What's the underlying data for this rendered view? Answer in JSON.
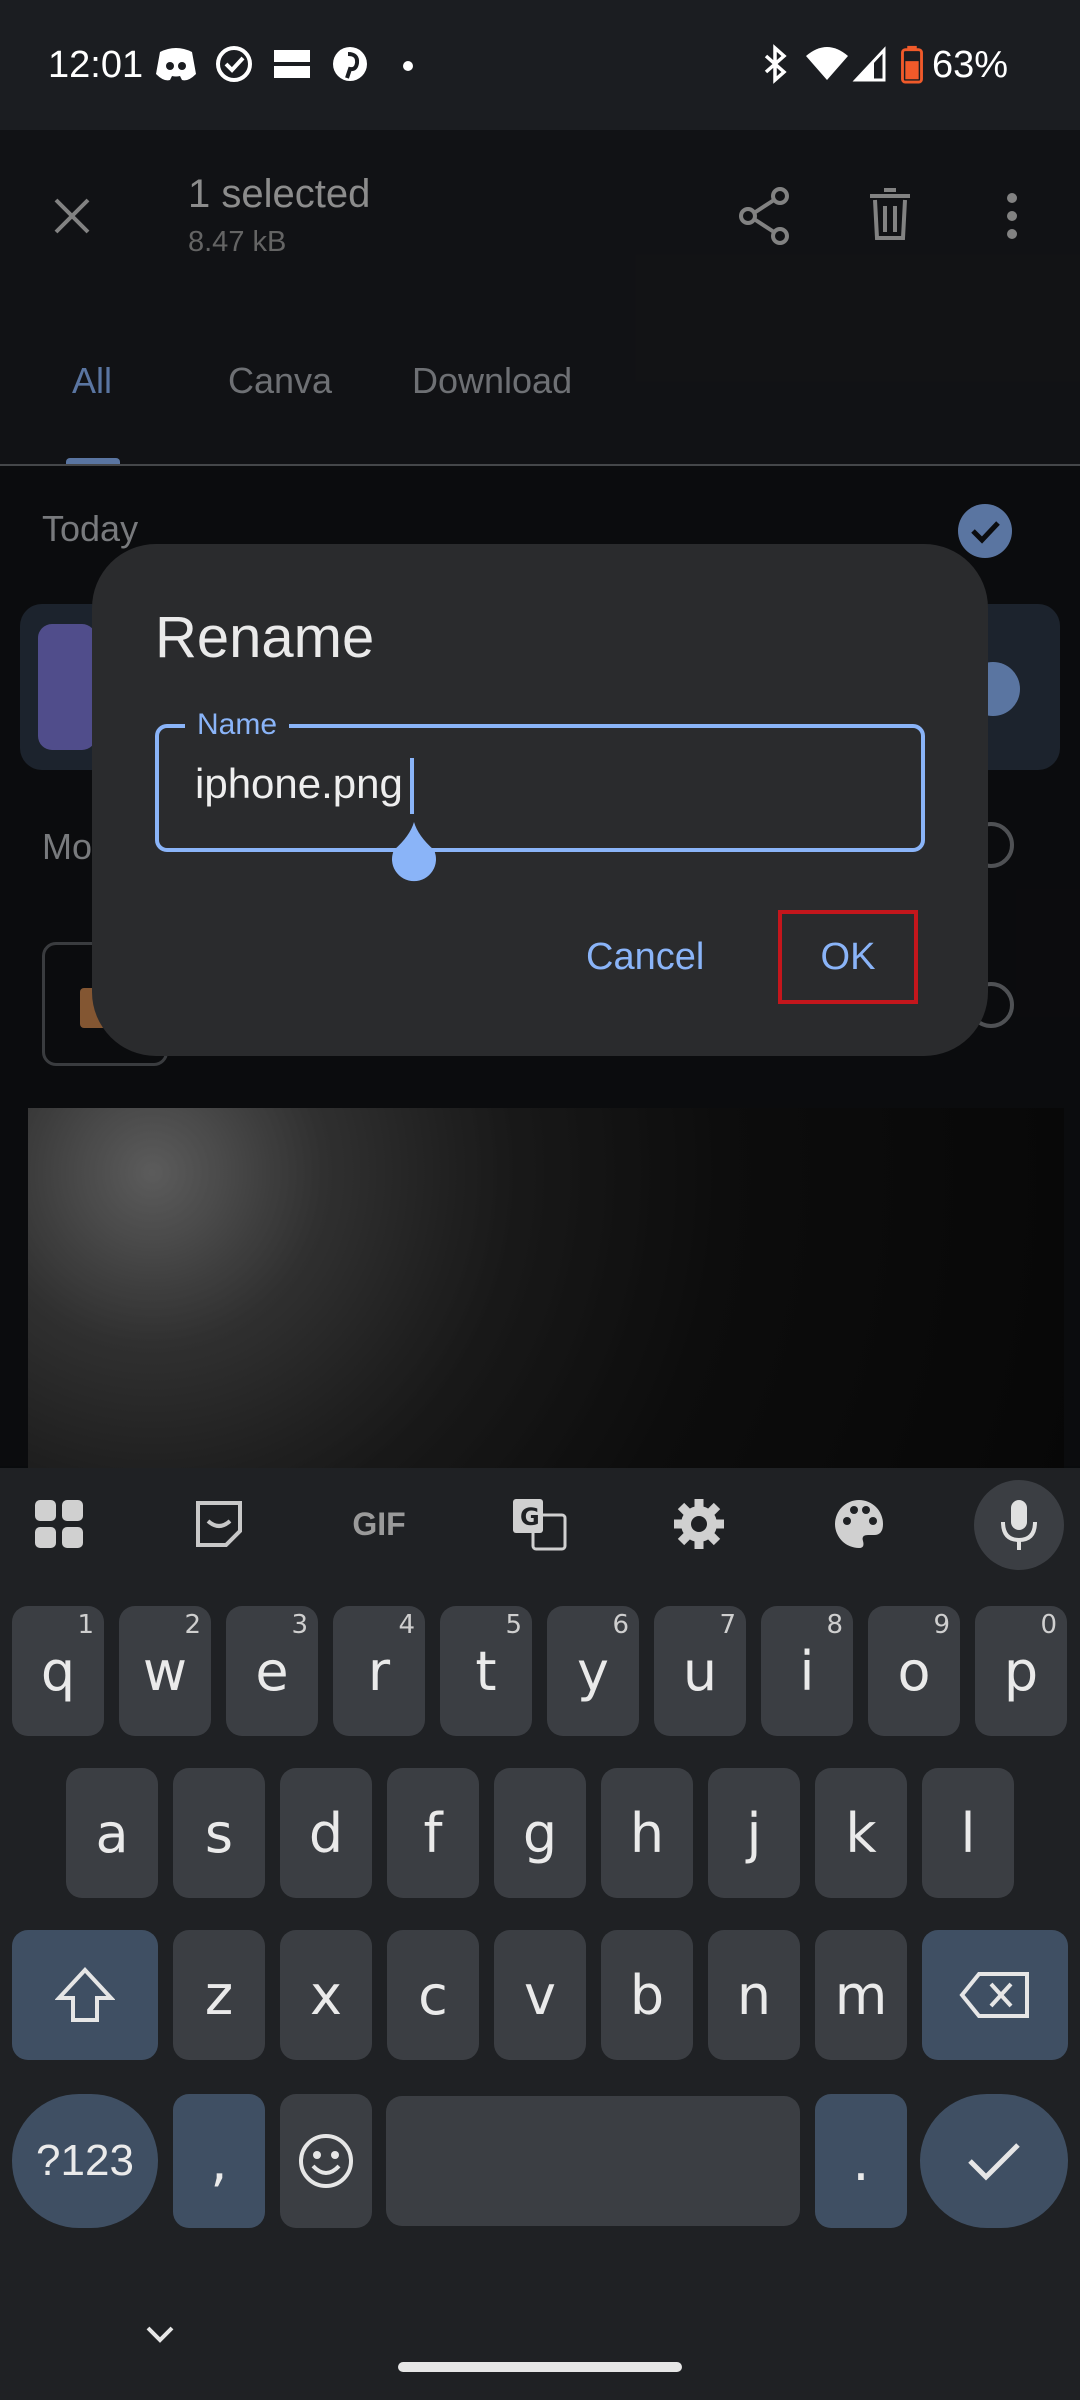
{
  "status_bar": {
    "time": "12:01",
    "battery": "63%",
    "left_icons": [
      "discord-icon",
      "check-circle-icon",
      "temu-icon",
      "pinterest-icon",
      "dot-icon"
    ],
    "right_icons": [
      "bluetooth-icon",
      "wifi-icon",
      "signal-icon",
      "battery-icon"
    ]
  },
  "app_bar": {
    "title": "1 selected",
    "subtitle": "8.47 kB",
    "actions": [
      "close-icon",
      "share-icon",
      "delete-icon",
      "more-vert-icon"
    ]
  },
  "tabs": [
    {
      "label": "All",
      "active": true
    },
    {
      "label": "Canva",
      "active": false
    },
    {
      "label": "Download",
      "active": false
    }
  ],
  "content": {
    "section_today": "Today",
    "section_partial": "Mo"
  },
  "dialog": {
    "title": "Rename",
    "field_label": "Name",
    "field_value": "iphone.png",
    "cancel_label": "Cancel",
    "ok_label": "OK",
    "highlight_color": "#c4161c"
  },
  "keyboard": {
    "toolbar": [
      "apps-grid-icon",
      "sticker-icon",
      "gif-icon",
      "translate-icon",
      "settings-icon",
      "palette-icon",
      "mic-icon"
    ],
    "gif_label": "GIF",
    "row1": [
      {
        "k": "q",
        "h": "1"
      },
      {
        "k": "w",
        "h": "2"
      },
      {
        "k": "e",
        "h": "3"
      },
      {
        "k": "r",
        "h": "4"
      },
      {
        "k": "t",
        "h": "5"
      },
      {
        "k": "y",
        "h": "6"
      },
      {
        "k": "u",
        "h": "7"
      },
      {
        "k": "i",
        "h": "8"
      },
      {
        "k": "o",
        "h": "9"
      },
      {
        "k": "p",
        "h": "0"
      }
    ],
    "row2": [
      "a",
      "s",
      "d",
      "f",
      "g",
      "h",
      "j",
      "k",
      "l"
    ],
    "row3": [
      "z",
      "x",
      "c",
      "v",
      "b",
      "n",
      "m"
    ],
    "symbols_label": "?123",
    "comma": ",",
    "period": "."
  },
  "colors": {
    "accent": "#8ab4f8",
    "keyboard_bg": "#1f2124",
    "key_bg": "#3b3e43",
    "key_dark_bg": "#3f4f63"
  }
}
